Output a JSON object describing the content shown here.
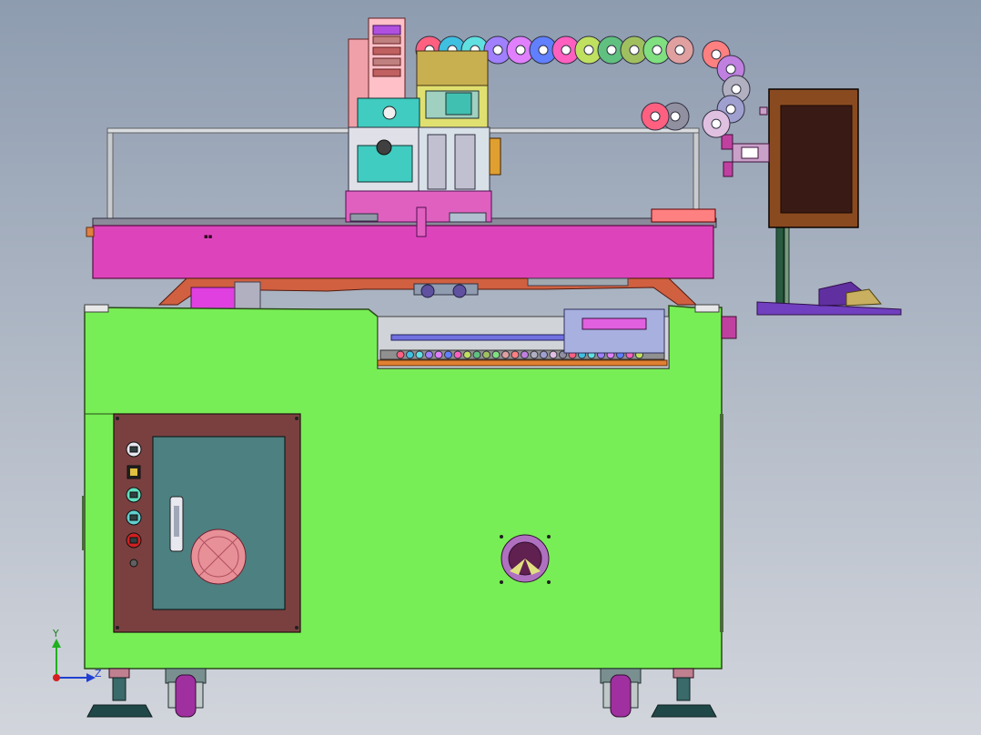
{
  "viewport": {
    "triad": {
      "x_label": "",
      "y_label": "Y",
      "z_label": "Z",
      "x_color": "#d42020",
      "y_color": "#20b020",
      "z_color": "#2040d0"
    }
  },
  "machine": {
    "colors": {
      "frame": "#77ee55",
      "frame_edge": "#2a4a1a",
      "gantry": "#dd44bb",
      "gantry_edge": "#5a1040",
      "door": "#7a4040",
      "door_glass": "#4d8080",
      "monitor": "#3a1a14",
      "monitor_frame": "#8a4a20",
      "head_teal": "#40ccc0",
      "head_olive": "#c8b050",
      "rail_silver": "#d8dce0",
      "caster_purple": "#a030a0",
      "foot_dark": "#204848"
    },
    "drag_chain_colors": [
      "#ff6080",
      "#40c0e0",
      "#60e0e0",
      "#a080ff",
      "#e080ff",
      "#6080ff",
      "#ff60c0",
      "#c0e060",
      "#60c080",
      "#a0c060",
      "#80e080",
      "#e0a0a0",
      "#ff8080",
      "#c080e0",
      "#b0b0c0",
      "#a0a0d0",
      "#e0c0e0",
      "#9090a0"
    ],
    "panel_icons": [
      "power-indicator-icon",
      "selector-switch-icon",
      "start-button-icon",
      "stop-button-icon",
      "emergency-stop-icon",
      "key-switch-icon"
    ]
  }
}
